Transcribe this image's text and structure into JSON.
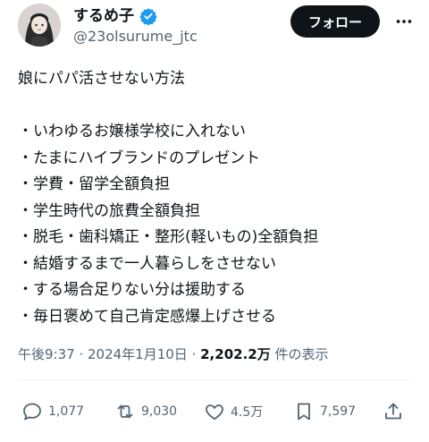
{
  "author": {
    "display_name": "するめ子",
    "handle": "@23olsurume_jtc",
    "verified_icon": "verified-badge-icon"
  },
  "header": {
    "follow_label": "フォロー",
    "more_icon": "more-horizontal-icon"
  },
  "tweet": {
    "text": "娘にパパ活させない方法\n\n・いわゆるお嬢様学校に入れない\n・たまにハイブランドのプレゼント\n・学費・留学全額負担\n・学生時代の旅費全額負担\n・脱毛・歯科矯正・整形(軽いもの)全額負担\n・結婚するまで一人暮らしをさせない\n・する場合足りない分は援助する\n・毎日褒めて自己肯定感爆上げさせる"
  },
  "meta": {
    "time": "午後9:37",
    "separator": " · ",
    "date": "2024年1月10日",
    "separator2": " · ",
    "views_count": "2,202.2万",
    "views_label": " 件の表示"
  },
  "actions": {
    "replies": "1,077",
    "retweets": "9,030",
    "likes": "4.5万",
    "bookmarks": "7,597"
  },
  "colors": {
    "text": "#0f1419",
    "secondary": "#536471",
    "verified": "#1d9bf0",
    "button_bg": "#0f1419",
    "button_text": "#ffffff"
  }
}
